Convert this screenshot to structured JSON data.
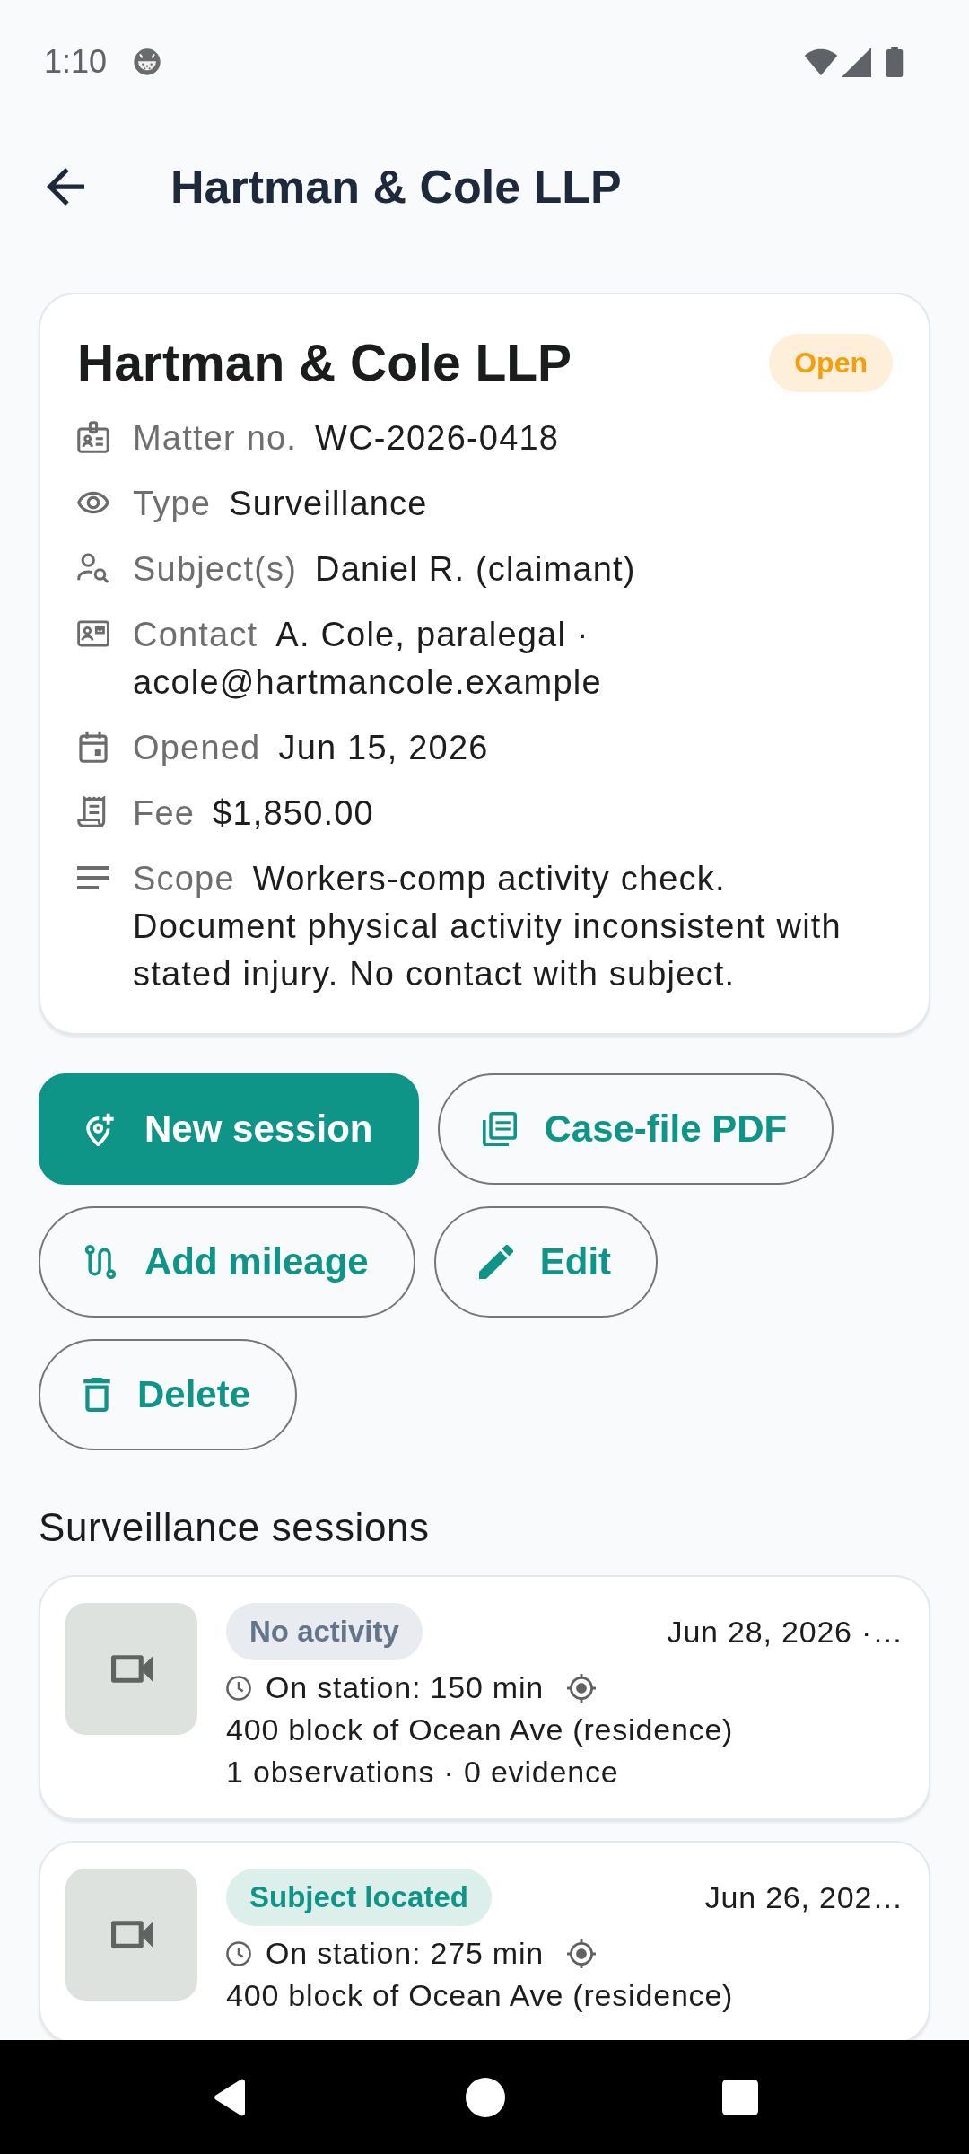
{
  "status_bar": {
    "time": "1:10"
  },
  "app_bar": {
    "title": "Hartman & Cole LLP"
  },
  "case": {
    "title": "Hartman & Cole LLP",
    "status": {
      "label": "Open",
      "kind": "open"
    },
    "fields": [
      {
        "kind": "matter",
        "label": "Matter no.",
        "value": "WC-2026-0418"
      },
      {
        "kind": "type",
        "label": "Type",
        "value": "Surveillance"
      },
      {
        "kind": "subject",
        "label": "Subject(s)",
        "value": "Daniel R. (claimant)"
      },
      {
        "kind": "contact",
        "label": "Contact",
        "value": "A. Cole, paralegal ·",
        "email": "acole@hartmancole.example"
      },
      {
        "kind": "opened",
        "label": "Opened",
        "value": "Jun 15, 2026"
      },
      {
        "kind": "fee",
        "label": "Fee",
        "value": "$1,850.00"
      },
      {
        "kind": "scope",
        "label": "Scope",
        "value": "Workers-comp activity check. Document physical activity inconsistent with stated injury. No contact with subject."
      }
    ]
  },
  "actions": [
    {
      "kind": "session",
      "label": "New session",
      "filled": true
    },
    {
      "kind": "pdf",
      "label": "Case-file PDF",
      "filled": false
    },
    {
      "kind": "mileage",
      "label": "Add mileage",
      "filled": false
    },
    {
      "kind": "edit",
      "label": "Edit",
      "filled": false
    },
    {
      "kind": "delete",
      "label": "Delete",
      "filled": false
    }
  ],
  "sessions": {
    "title": "Surveillance sessions",
    "items": [
      {
        "status": {
          "label": "No activity",
          "kind": "neutral"
        },
        "date": "Jun 28, 2026 ·…",
        "on_station": "On station: 150 min",
        "geotagged": true,
        "location": "400 block of Ocean Ave (residence)",
        "counts": "1 observations · 0 evidence"
      },
      {
        "status": {
          "label": "Subject located",
          "kind": "located"
        },
        "date": "Jun 26, 202…",
        "on_station": "On station: 275 min",
        "geotagged": true,
        "location": "400 block of Ocean Ave (residence)"
      }
    ]
  }
}
